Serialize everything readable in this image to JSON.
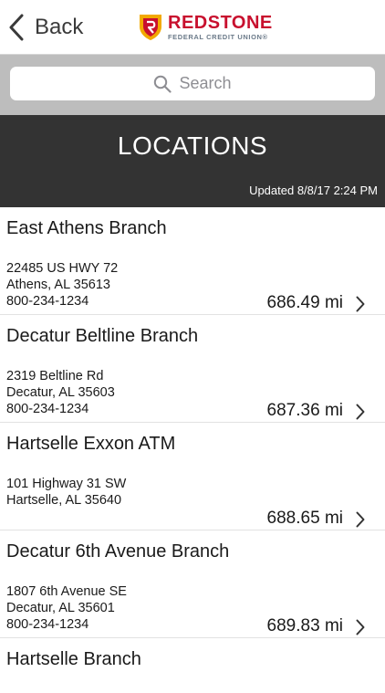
{
  "nav": {
    "back_label": "Back",
    "logo_name": "REDSTONE",
    "logo_sub": "FEDERAL CREDIT UNION®"
  },
  "search": {
    "placeholder": "Search"
  },
  "header": {
    "title": "LOCATIONS",
    "updated": "Updated 8/8/17 2:24 PM"
  },
  "colors": {
    "brand_red": "#c8102e",
    "brand_gold": "#f2a900",
    "header_bg": "#333333",
    "search_bg": "#bdbdbd"
  },
  "locations": [
    {
      "name": "East Athens Branch",
      "street": "22485 US HWY 72",
      "city": "Athens, AL 35613",
      "phone": "800-234-1234",
      "distance": "686.49 mi"
    },
    {
      "name": "Decatur Beltline Branch",
      "street": "2319 Beltline Rd",
      "city": "Decatur, AL 35603",
      "phone": "800-234-1234",
      "distance": "687.36 mi"
    },
    {
      "name": "Hartselle Exxon ATM",
      "street": "101 Highway 31 SW",
      "city": "Hartselle, AL 35640",
      "phone": "",
      "distance": "688.65 mi"
    },
    {
      "name": "Decatur 6th Avenue Branch",
      "street": "1807 6th Avenue SE",
      "city": "Decatur, AL 35601",
      "phone": "800-234-1234",
      "distance": "689.83 mi"
    },
    {
      "name": "Hartselle Branch",
      "street": "",
      "city": "",
      "phone": "",
      "distance": ""
    }
  ]
}
